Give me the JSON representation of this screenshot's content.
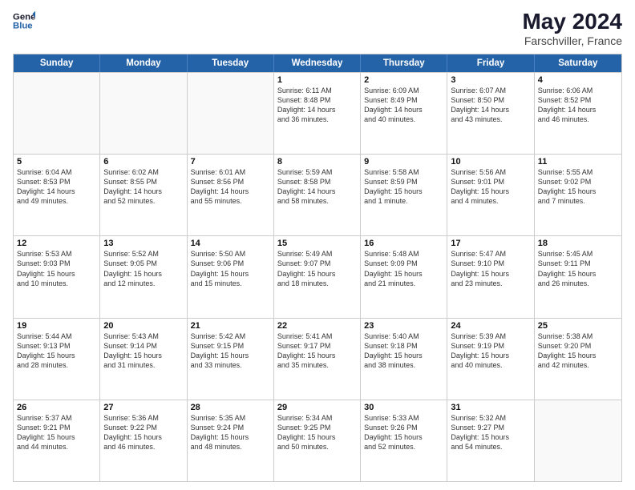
{
  "header": {
    "logo_line1": "General",
    "logo_line2": "Blue",
    "month_year": "May 2024",
    "location": "Farschviller, France"
  },
  "days_of_week": [
    "Sunday",
    "Monday",
    "Tuesday",
    "Wednesday",
    "Thursday",
    "Friday",
    "Saturday"
  ],
  "weeks": [
    [
      {
        "day": "",
        "info": ""
      },
      {
        "day": "",
        "info": ""
      },
      {
        "day": "",
        "info": ""
      },
      {
        "day": "1",
        "info": "Sunrise: 6:11 AM\nSunset: 8:48 PM\nDaylight: 14 hours\nand 36 minutes."
      },
      {
        "day": "2",
        "info": "Sunrise: 6:09 AM\nSunset: 8:49 PM\nDaylight: 14 hours\nand 40 minutes."
      },
      {
        "day": "3",
        "info": "Sunrise: 6:07 AM\nSunset: 8:50 PM\nDaylight: 14 hours\nand 43 minutes."
      },
      {
        "day": "4",
        "info": "Sunrise: 6:06 AM\nSunset: 8:52 PM\nDaylight: 14 hours\nand 46 minutes."
      }
    ],
    [
      {
        "day": "5",
        "info": "Sunrise: 6:04 AM\nSunset: 8:53 PM\nDaylight: 14 hours\nand 49 minutes."
      },
      {
        "day": "6",
        "info": "Sunrise: 6:02 AM\nSunset: 8:55 PM\nDaylight: 14 hours\nand 52 minutes."
      },
      {
        "day": "7",
        "info": "Sunrise: 6:01 AM\nSunset: 8:56 PM\nDaylight: 14 hours\nand 55 minutes."
      },
      {
        "day": "8",
        "info": "Sunrise: 5:59 AM\nSunset: 8:58 PM\nDaylight: 14 hours\nand 58 minutes."
      },
      {
        "day": "9",
        "info": "Sunrise: 5:58 AM\nSunset: 8:59 PM\nDaylight: 15 hours\nand 1 minute."
      },
      {
        "day": "10",
        "info": "Sunrise: 5:56 AM\nSunset: 9:01 PM\nDaylight: 15 hours\nand 4 minutes."
      },
      {
        "day": "11",
        "info": "Sunrise: 5:55 AM\nSunset: 9:02 PM\nDaylight: 15 hours\nand 7 minutes."
      }
    ],
    [
      {
        "day": "12",
        "info": "Sunrise: 5:53 AM\nSunset: 9:03 PM\nDaylight: 15 hours\nand 10 minutes."
      },
      {
        "day": "13",
        "info": "Sunrise: 5:52 AM\nSunset: 9:05 PM\nDaylight: 15 hours\nand 12 minutes."
      },
      {
        "day": "14",
        "info": "Sunrise: 5:50 AM\nSunset: 9:06 PM\nDaylight: 15 hours\nand 15 minutes."
      },
      {
        "day": "15",
        "info": "Sunrise: 5:49 AM\nSunset: 9:07 PM\nDaylight: 15 hours\nand 18 minutes."
      },
      {
        "day": "16",
        "info": "Sunrise: 5:48 AM\nSunset: 9:09 PM\nDaylight: 15 hours\nand 21 minutes."
      },
      {
        "day": "17",
        "info": "Sunrise: 5:47 AM\nSunset: 9:10 PM\nDaylight: 15 hours\nand 23 minutes."
      },
      {
        "day": "18",
        "info": "Sunrise: 5:45 AM\nSunset: 9:11 PM\nDaylight: 15 hours\nand 26 minutes."
      }
    ],
    [
      {
        "day": "19",
        "info": "Sunrise: 5:44 AM\nSunset: 9:13 PM\nDaylight: 15 hours\nand 28 minutes."
      },
      {
        "day": "20",
        "info": "Sunrise: 5:43 AM\nSunset: 9:14 PM\nDaylight: 15 hours\nand 31 minutes."
      },
      {
        "day": "21",
        "info": "Sunrise: 5:42 AM\nSunset: 9:15 PM\nDaylight: 15 hours\nand 33 minutes."
      },
      {
        "day": "22",
        "info": "Sunrise: 5:41 AM\nSunset: 9:17 PM\nDaylight: 15 hours\nand 35 minutes."
      },
      {
        "day": "23",
        "info": "Sunrise: 5:40 AM\nSunset: 9:18 PM\nDaylight: 15 hours\nand 38 minutes."
      },
      {
        "day": "24",
        "info": "Sunrise: 5:39 AM\nSunset: 9:19 PM\nDaylight: 15 hours\nand 40 minutes."
      },
      {
        "day": "25",
        "info": "Sunrise: 5:38 AM\nSunset: 9:20 PM\nDaylight: 15 hours\nand 42 minutes."
      }
    ],
    [
      {
        "day": "26",
        "info": "Sunrise: 5:37 AM\nSunset: 9:21 PM\nDaylight: 15 hours\nand 44 minutes."
      },
      {
        "day": "27",
        "info": "Sunrise: 5:36 AM\nSunset: 9:22 PM\nDaylight: 15 hours\nand 46 minutes."
      },
      {
        "day": "28",
        "info": "Sunrise: 5:35 AM\nSunset: 9:24 PM\nDaylight: 15 hours\nand 48 minutes."
      },
      {
        "day": "29",
        "info": "Sunrise: 5:34 AM\nSunset: 9:25 PM\nDaylight: 15 hours\nand 50 minutes."
      },
      {
        "day": "30",
        "info": "Sunrise: 5:33 AM\nSunset: 9:26 PM\nDaylight: 15 hours\nand 52 minutes."
      },
      {
        "day": "31",
        "info": "Sunrise: 5:32 AM\nSunset: 9:27 PM\nDaylight: 15 hours\nand 54 minutes."
      },
      {
        "day": "",
        "info": ""
      }
    ]
  ]
}
